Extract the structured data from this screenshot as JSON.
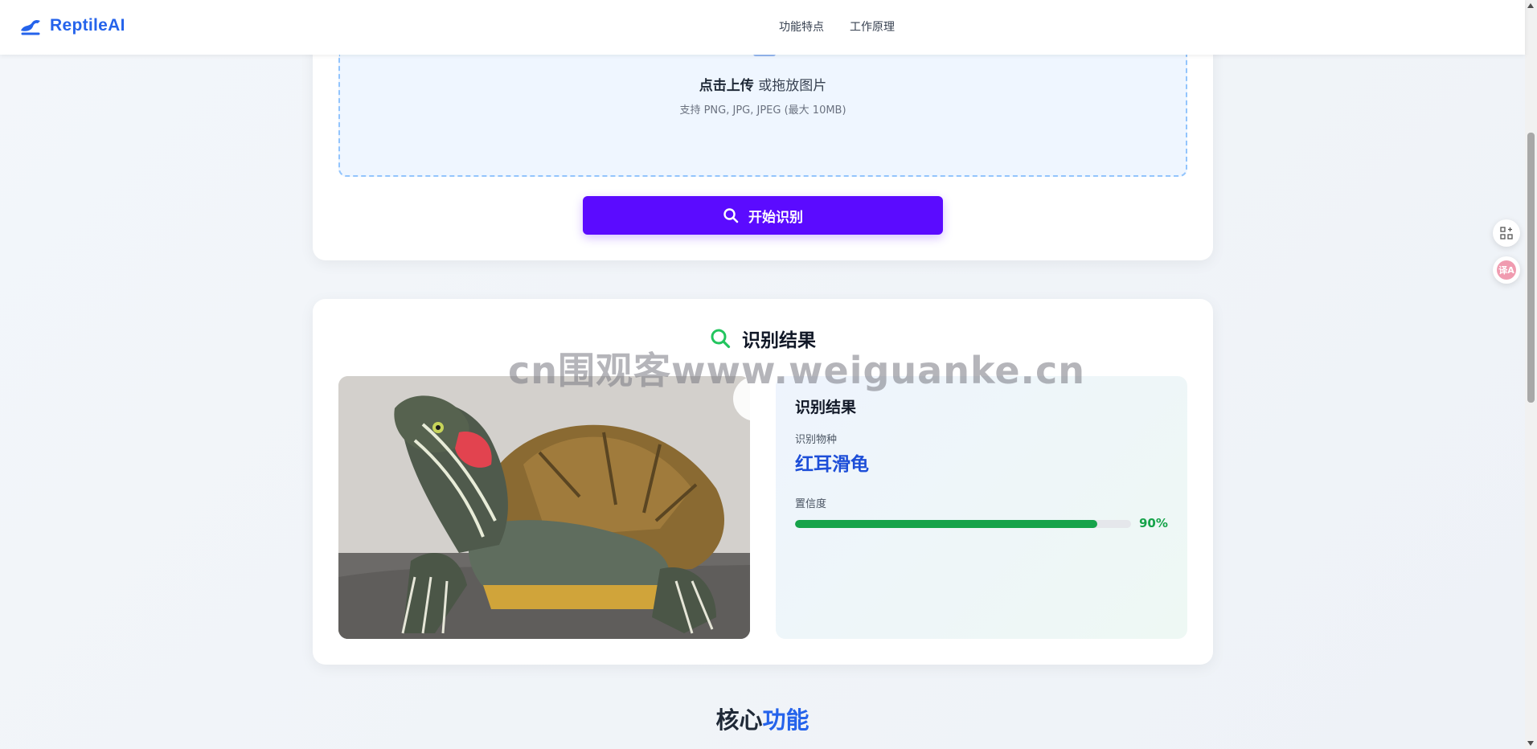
{
  "header": {
    "brand": "ReptileAI",
    "nav": [
      {
        "label": "功能特点"
      },
      {
        "label": "工作原理"
      }
    ]
  },
  "upload": {
    "click_text": "点击上传",
    "drag_text": "或拖放图片",
    "hint": "支持 PNG, JPG, JPEG (最大 10MB)",
    "start_button": "开始识别"
  },
  "result": {
    "title": "识别结果",
    "panel_heading": "识别结果",
    "species_label": "识别物种",
    "species_name": "红耳滑龟",
    "confidence_label": "置信度",
    "confidence_value": "90%",
    "confidence_fraction": 0.9
  },
  "core": {
    "title_prefix": "核心",
    "title_accent": "功能"
  },
  "watermark": "cn围观客www.weiguanke.cn",
  "side_buttons": {
    "translate_label": "译A"
  },
  "colors": {
    "brand": "#2563eb",
    "button": "#5b0bff",
    "success": "#16a34a"
  }
}
